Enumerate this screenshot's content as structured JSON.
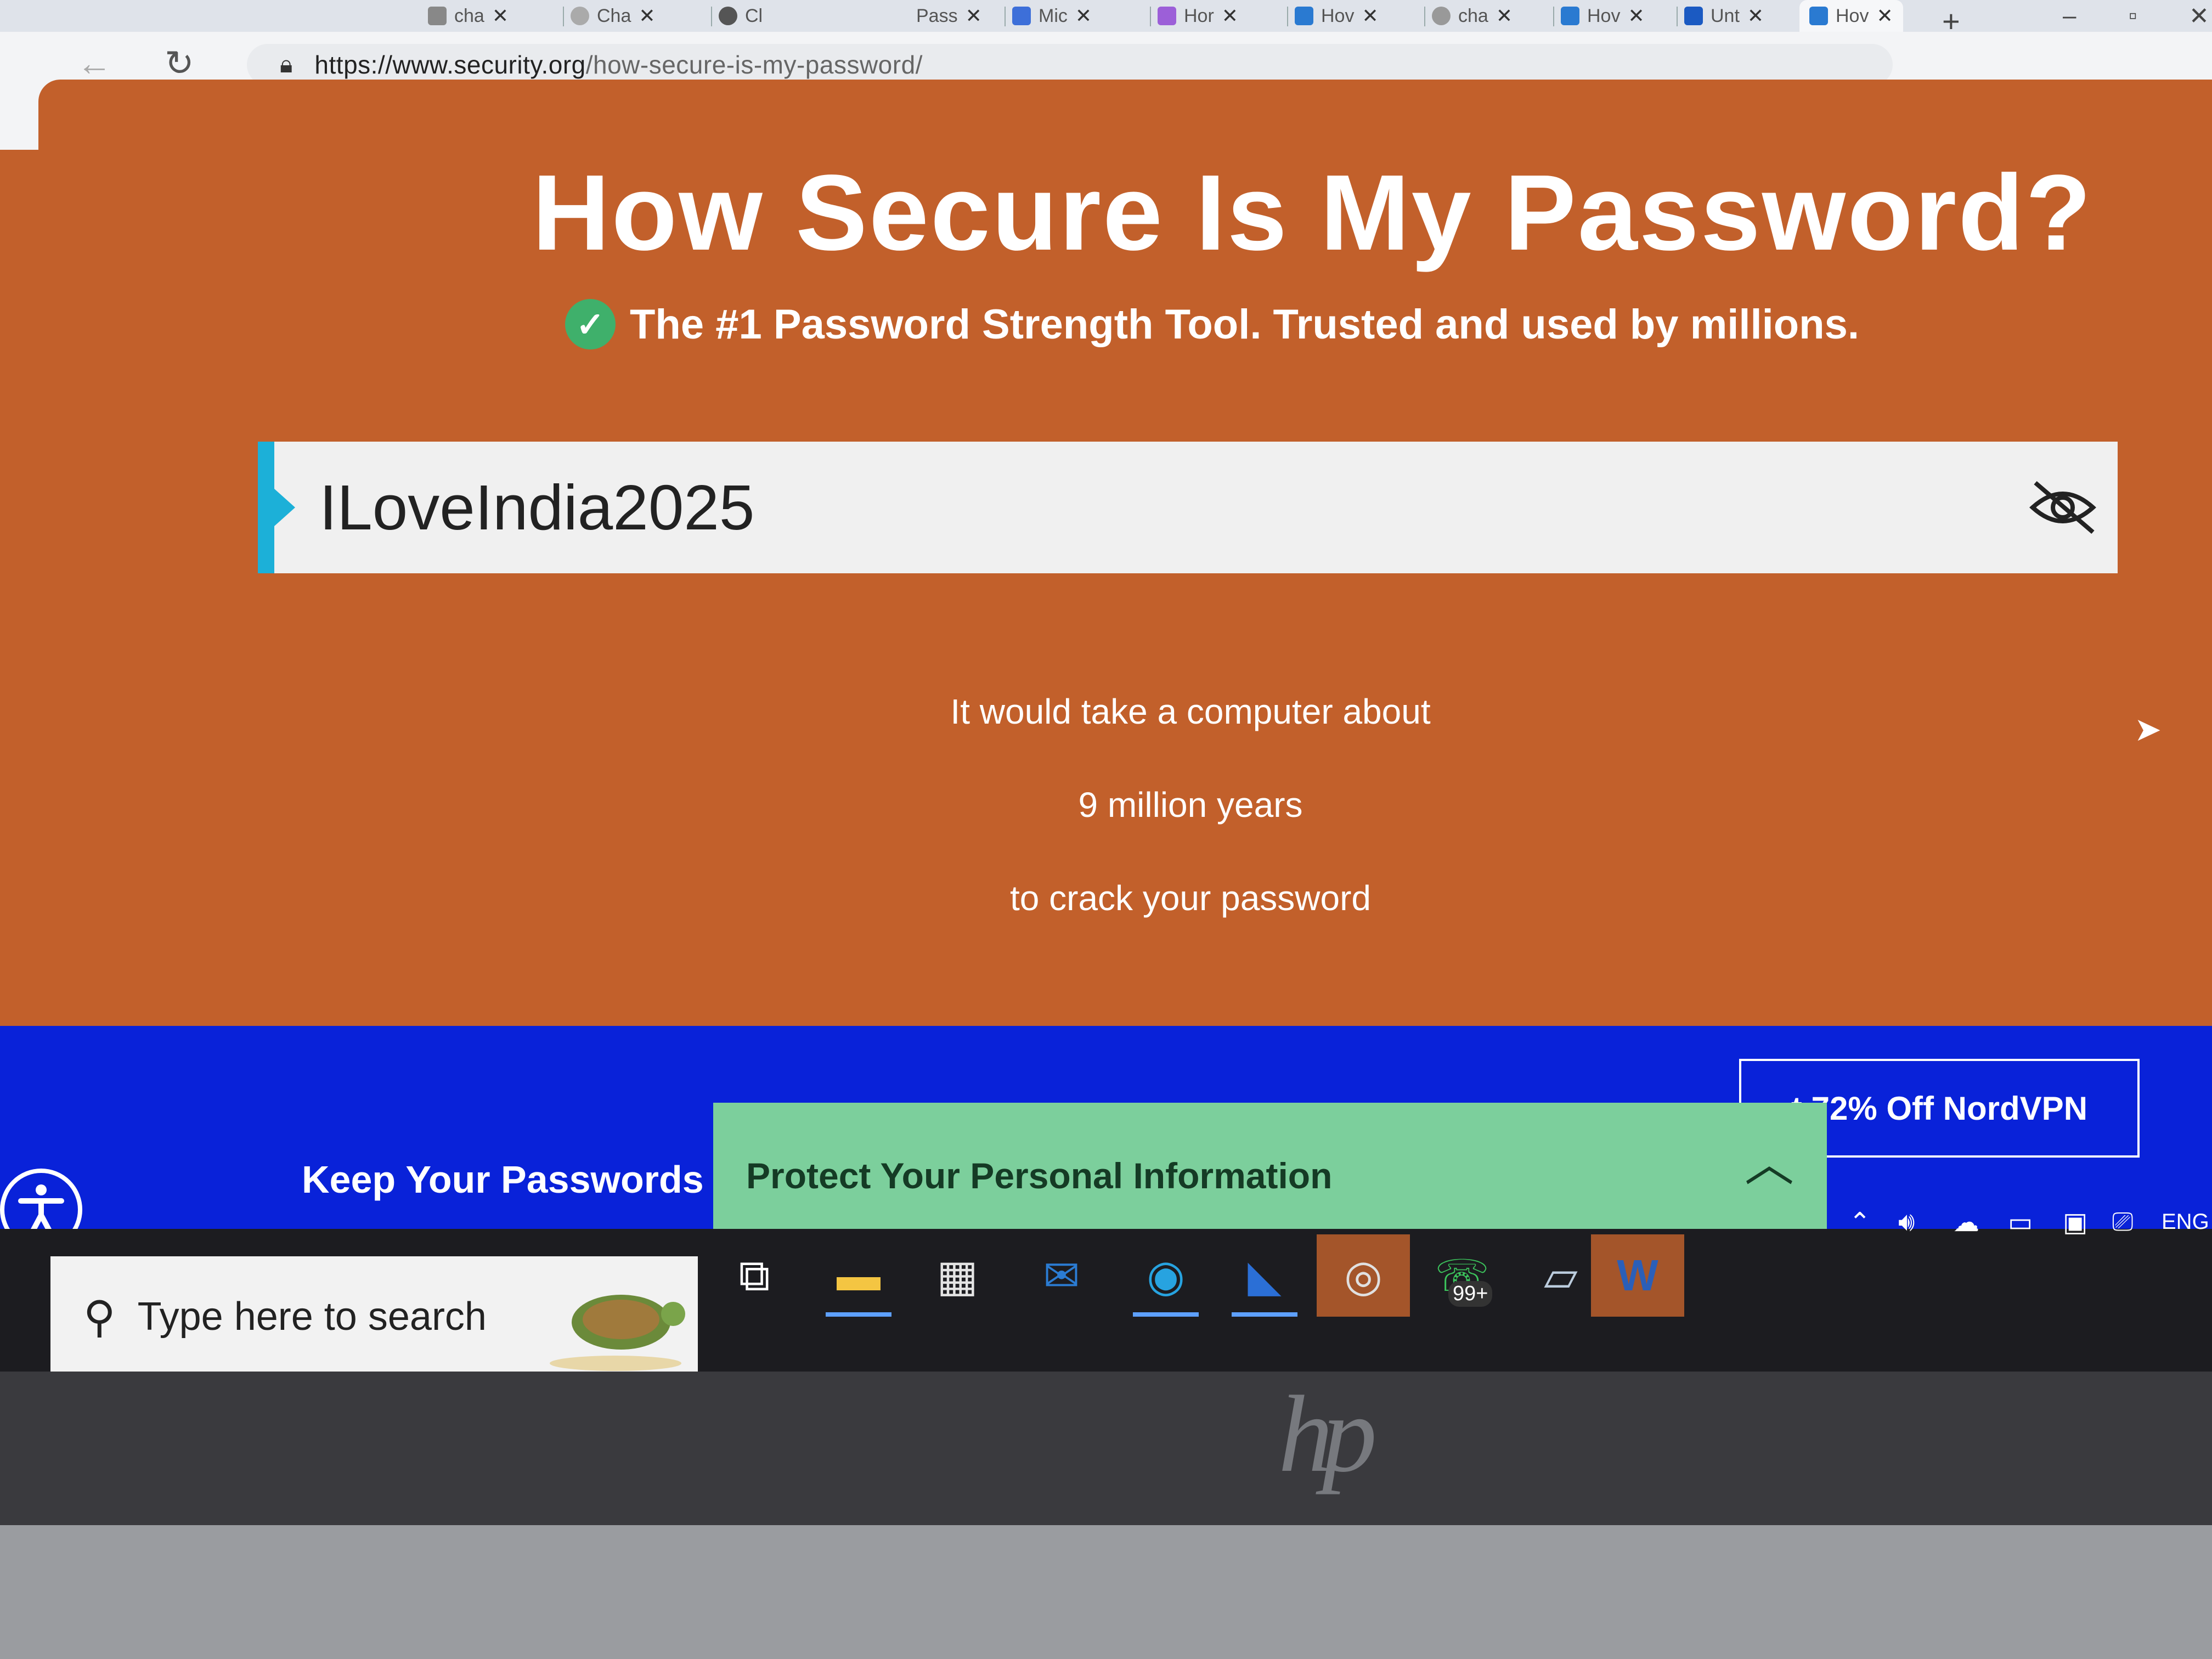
{
  "browser": {
    "tabs": [
      {
        "label": "cha",
        "color": "#777"
      },
      {
        "label": "Cha",
        "color": "#888"
      },
      {
        "label": "Cl",
        "color": "#444"
      },
      {
        "label": "Pass",
        "color": "#999"
      },
      {
        "label": "Mic",
        "color": "#3d6fd9"
      },
      {
        "label": "Hor",
        "color": "#9c5fd8"
      },
      {
        "label": "Hov",
        "color": "#2a7ad1"
      },
      {
        "label": "cha",
        "color": "#888"
      },
      {
        "label": "Hov",
        "color": "#2a7ad1"
      },
      {
        "label": "Unt",
        "color": "#1b5ac2"
      },
      {
        "label": "Hov",
        "color": "#2a7ad1"
      }
    ],
    "new_tab": "+",
    "url_main": "https://www.security.org",
    "url_path": "/how-secure-is-my-password/"
  },
  "page": {
    "title": "How Secure Is My Password?",
    "subtitle": "The #1 Password Strength Tool. Trusted and used by millions.",
    "password_value": "ILoveIndia2025",
    "result_line1": "It would take a computer about",
    "result_time": "9 million years",
    "result_line3": "to crack your password"
  },
  "banner": {
    "keep_text": "Keep Your Passwords",
    "protect_text": "Protect Your Personal Information",
    "nord_text": "t 72% Off NordVPN"
  },
  "taskbar": {
    "search_placeholder": "Type here to search",
    "whatsapp_badge": "99+",
    "language": "ENG"
  },
  "colors": {
    "page_bg": "#c2602b",
    "banner_blue": "#0922d9",
    "protect_green": "#7ccf9c",
    "accent_cyan": "#1cb0d8",
    "check_green": "#3fb06b"
  }
}
